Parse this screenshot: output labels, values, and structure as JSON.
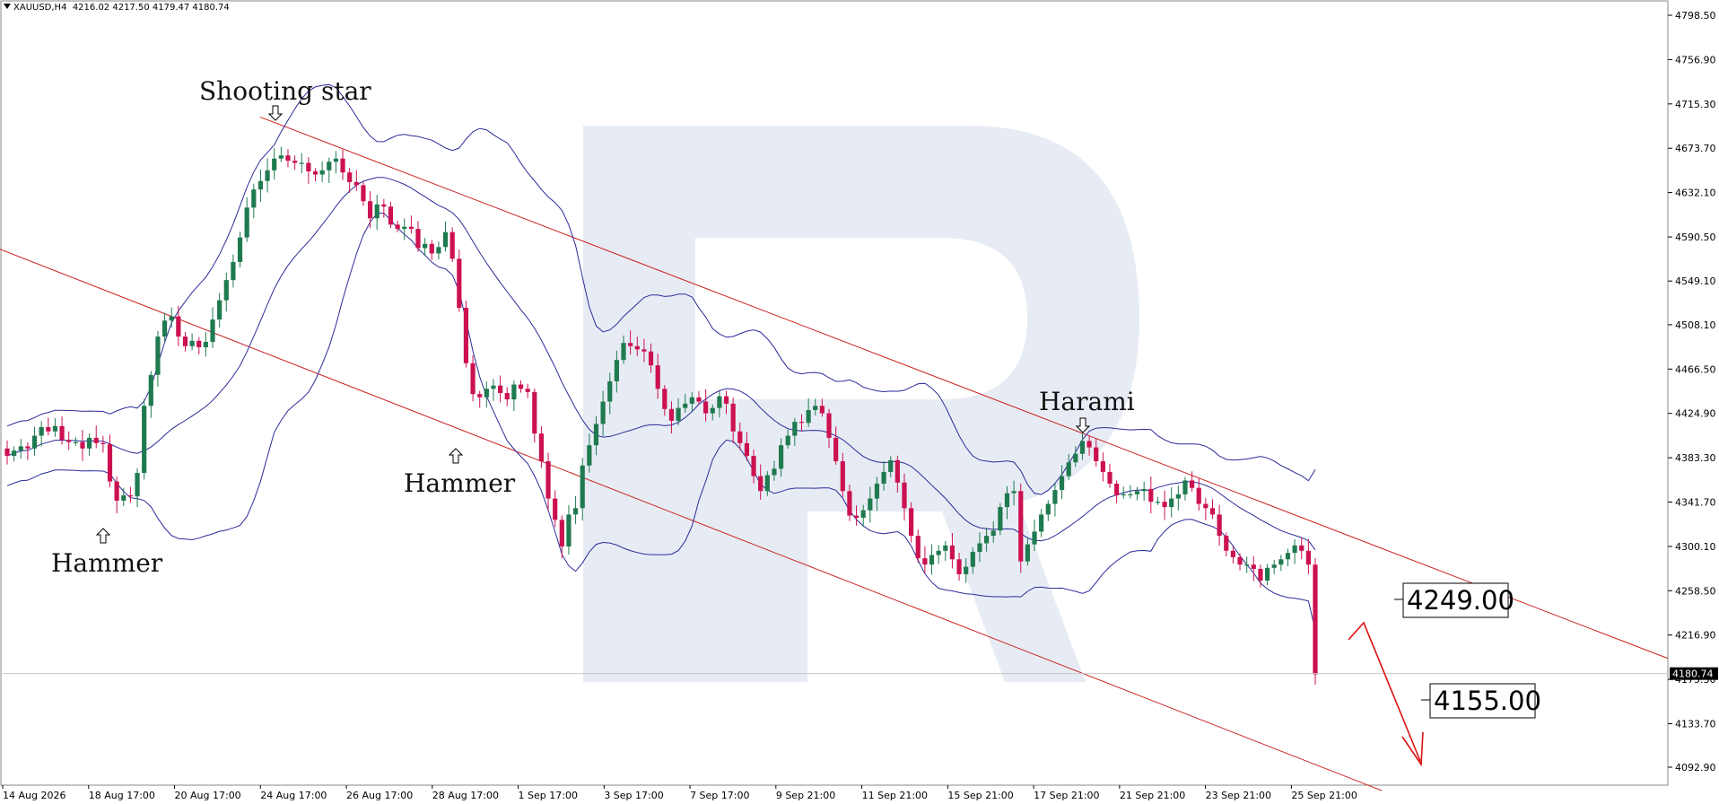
{
  "window": {
    "symbol": "XAUUSD,H4",
    "ohlc": "4216.02 4217.50 4179.47 4180.74"
  },
  "colors": {
    "bull": "#1f7a4f",
    "bear": "#cc1150",
    "bands": "#2b2b9a",
    "channel": "#cc2222",
    "arrow": "#dd1111",
    "watermark": "#dfe5f0",
    "grid_text": "#000000"
  },
  "chart_data": {
    "type": "candlestick",
    "instrument": "XAUUSD",
    "timeframe": "H4",
    "ylim": [
      4071.1,
      4819.3
    ],
    "y_ticks": [
      "4798.50",
      "4756.90",
      "4715.30",
      "4673.70",
      "4632.10",
      "4590.50",
      "4549.10",
      "4508.10",
      "4466.50",
      "4424.90",
      "4383.30",
      "4341.70",
      "4300.10",
      "4258.50",
      "4216.90",
      "4175.30",
      "4133.70",
      "4092.90"
    ],
    "x_ticks": [
      "14 Aug 2026",
      "18 Aug 17:00",
      "20 Aug 17:00",
      "24 Aug 17:00",
      "26 Aug 17:00",
      "28 Aug 17:00",
      "1 Sep 17:00",
      "3 Sep 17:00",
      "7 Sep 17:00",
      "9 Sep 21:00",
      "11 Sep 21:00",
      "15 Sep 21:00",
      "17 Sep 21:00",
      "21 Sep 21:00",
      "23 Sep 21:00",
      "25 Sep 21:00"
    ],
    "current_price": "4180.74",
    "candles_close": [
      4385,
      4390,
      4394,
      4392,
      4404,
      4412,
      4408,
      4413,
      4400,
      4398,
      4398,
      4392,
      4402,
      4397,
      4396,
      4361,
      4343,
      4348,
      4347,
      4369,
      4432,
      4461,
      4497,
      4512,
      4516,
      4497,
      4488,
      4493,
      4487,
      4492,
      4513,
      4531,
      4550,
      4567,
      4590,
      4618,
      4635,
      4643,
      4653,
      4664,
      4667,
      4662,
      4660,
      4660,
      4652,
      4649,
      4653,
      4661,
      4664,
      4651,
      4642,
      4639,
      4624,
      4608,
      4621,
      4619,
      4602,
      4598,
      4600,
      4598,
      4580,
      4584,
      4575,
      4581,
      4595,
      4570,
      4524,
      4472,
      4443,
      4440,
      4448,
      4451,
      4444,
      4438,
      4452,
      4448,
      4445,
      4406,
      4380,
      4345,
      4325,
      4300,
      4330,
      4336,
      4376,
      4395,
      4415,
      4436,
      4455,
      4475,
      4491,
      4488,
      4485,
      4483,
      4470,
      4448,
      4429,
      4418,
      4430,
      4434,
      4440,
      4436,
      4425,
      4430,
      4441,
      4434,
      4408,
      4397,
      4385,
      4366,
      4352,
      4367,
      4373,
      4395,
      4404,
      4417,
      4416,
      4428,
      4432,
      4425,
      4402,
      4380,
      4352,
      4329,
      4327,
      4334,
      4345,
      4359,
      4370,
      4381,
      4360,
      4336,
      4310,
      4289,
      4283,
      4292,
      4296,
      4301,
      4288,
      4274,
      4281,
      4295,
      4303,
      4310,
      4315,
      4337,
      4350,
      4352,
      4286,
      4302,
      4314,
      4330,
      4340,
      4353,
      4366,
      4379,
      4387,
      4399,
      4393,
      4380,
      4370,
      4359,
      4348,
      4349,
      4349,
      4352,
      4354,
      4342,
      4342,
      4337,
      4345,
      4349,
      4362,
      4355,
      4340,
      4336,
      4330,
      4310,
      4296,
      4290,
      4283,
      4283,
      4279,
      4268,
      4280,
      4283,
      4288,
      4294,
      4301,
      4296,
      4283,
      4180
    ],
    "bollinger_bands": [
      "upper",
      "middle",
      "lower"
    ],
    "channel_lines": [
      "upper",
      "lower"
    ],
    "annotations": [
      {
        "label": "Shooting star",
        "marker": "down-arrow"
      },
      {
        "label": "Hammer",
        "marker": "up-arrow"
      },
      {
        "label": "Hammer",
        "marker": "up-arrow"
      },
      {
        "label": "Harami",
        "marker": "down-arrow"
      }
    ],
    "price_boxes": [
      "4249.00",
      "4155.00"
    ]
  }
}
